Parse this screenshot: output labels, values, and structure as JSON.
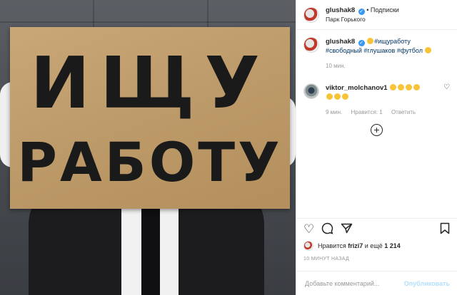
{
  "photo": {
    "sign_line1": "ИЩУ",
    "sign_line2": "РАБОТУ"
  },
  "header": {
    "username": "glushak8",
    "separator": "•",
    "follow_label": "Подписки",
    "location": "Парк Горького"
  },
  "caption": {
    "username": "glushak8",
    "tags": [
      "#ищуработу",
      "#свободный",
      "#глушаков",
      "#футбол"
    ],
    "time": "10 мин."
  },
  "comment": {
    "username": "viktor_molchanov1",
    "time": "9 мин.",
    "likes": "Нравится: 1",
    "reply": "Ответить"
  },
  "likes_line": {
    "prefix": "Нравится",
    "user": "frizi7",
    "middle": "и ещё",
    "count": "1 214"
  },
  "time_ago": "10 МИНУТ НАЗАД",
  "add_comment": {
    "placeholder": "Добавьте комментарий...",
    "publish_label": "Опубликовать"
  },
  "icons": [
    "heart-icon",
    "comment-icon",
    "share-icon",
    "bookmark-icon",
    "verified-icon",
    "add-circle-icon"
  ],
  "colors": {
    "hashtag": "#003569",
    "verified": "#3897f0",
    "publish_disabled": "#b2dffc",
    "meta": "#999999"
  }
}
